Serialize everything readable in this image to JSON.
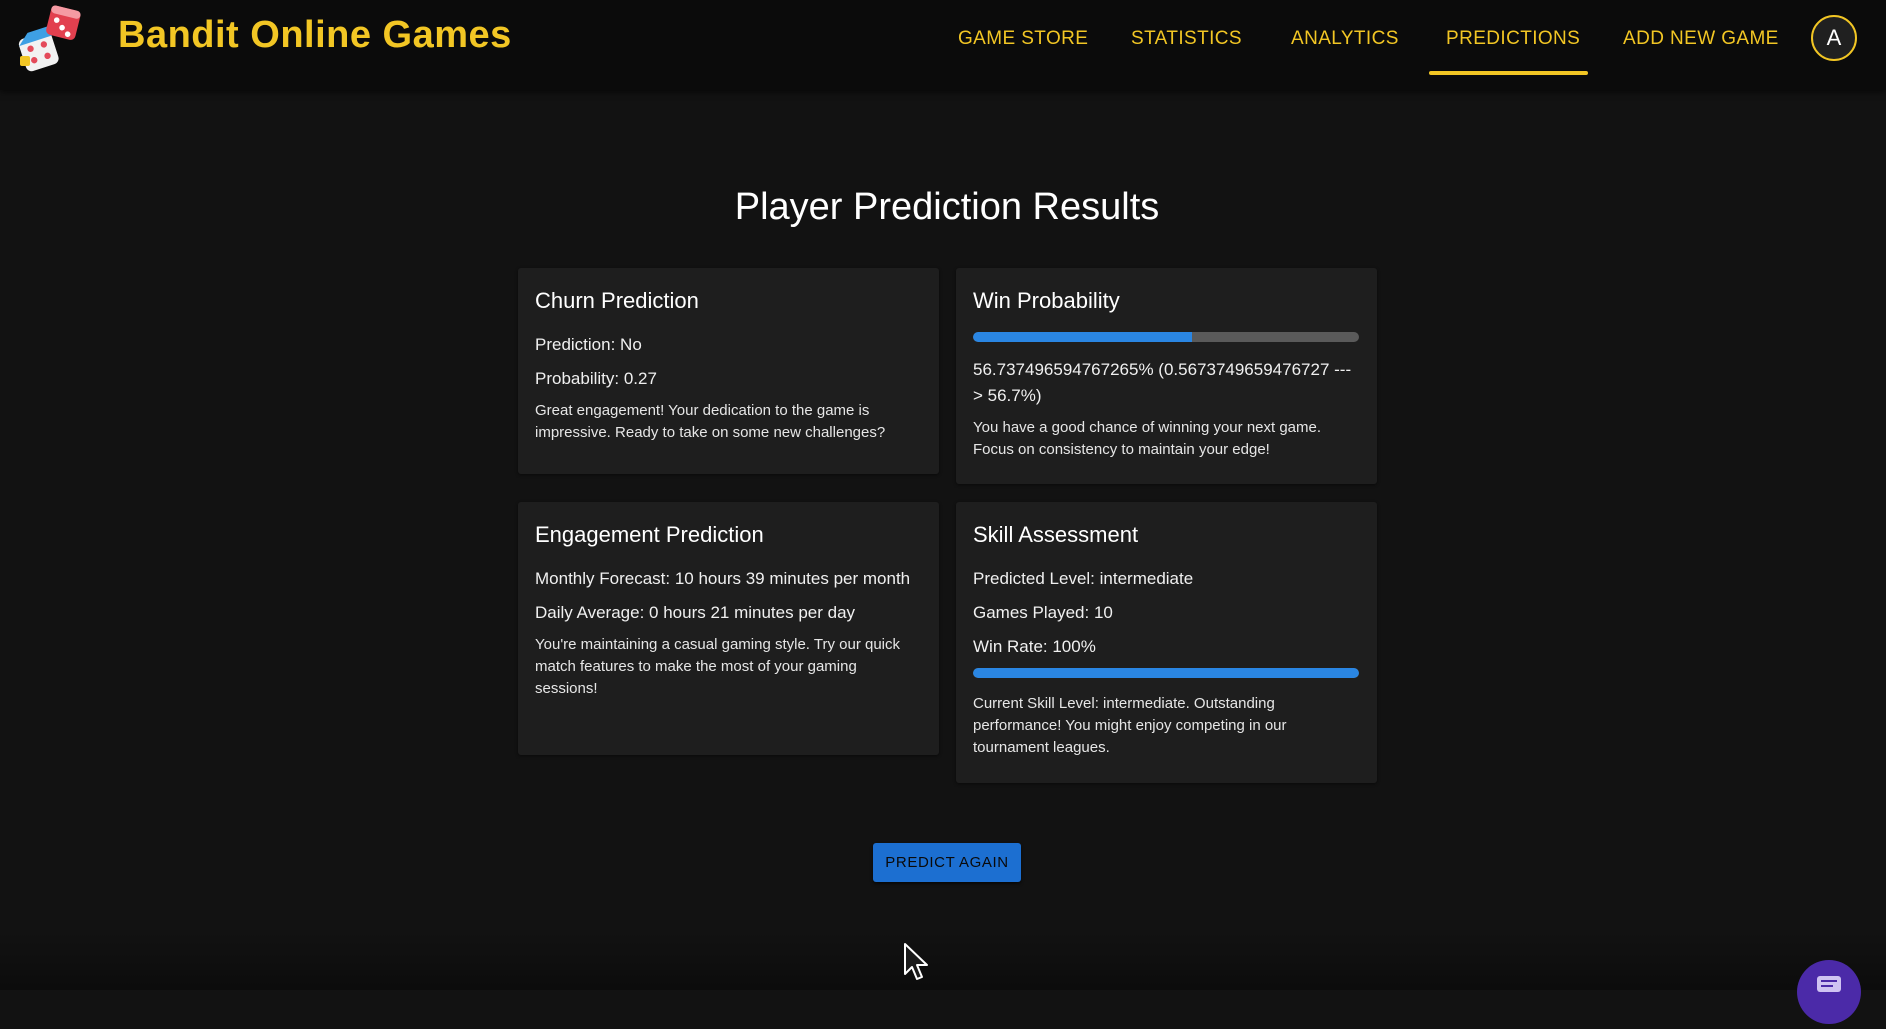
{
  "header": {
    "brand": "Bandit Online Games",
    "nav": [
      {
        "label": "GAME STORE"
      },
      {
        "label": "STATISTICS"
      },
      {
        "label": "ANALYTICS"
      },
      {
        "label": "PREDICTIONS"
      },
      {
        "label": "ADD NEW GAME"
      }
    ],
    "active_nav": "PREDICTIONS",
    "avatar_initial": "A",
    "accent_color": "#f2c624"
  },
  "main": {
    "title": "Player Prediction Results",
    "churn": {
      "title": "Churn Prediction",
      "prediction": "Prediction: No",
      "probability": "Probability: 0.27",
      "note": "Great engagement! Your dedication to the game is impressive. Ready to take on some new challenges?"
    },
    "win": {
      "title": "Win Probability",
      "progress_fraction": 0.567,
      "value_text": "56.737496594767265% (0.5673749659476727 ---> 56.7%)",
      "note": "You have a good chance of winning your next game. Focus on consistency to maintain your edge!"
    },
    "engagement": {
      "title": "Engagement Prediction",
      "monthly": "Monthly Forecast: 10 hours 39 minutes per month",
      "daily": "Daily Average: 0 hours 21 minutes per day",
      "note": "You're maintaining a casual gaming style. Try our quick match features to make the most of your gaming sessions!"
    },
    "skill": {
      "title": "Skill Assessment",
      "level": "Predicted Level: intermediate",
      "games": "Games Played: 10",
      "win_rate": "Win Rate: 100%",
      "progress_fraction": 1.0,
      "note": "Current Skill Level: intermediate. Outstanding performance! You might enjoy competing in our tournament leagues."
    },
    "predict_again_label": "PREDICT AGAIN",
    "bar_color": "#2a86e3"
  }
}
